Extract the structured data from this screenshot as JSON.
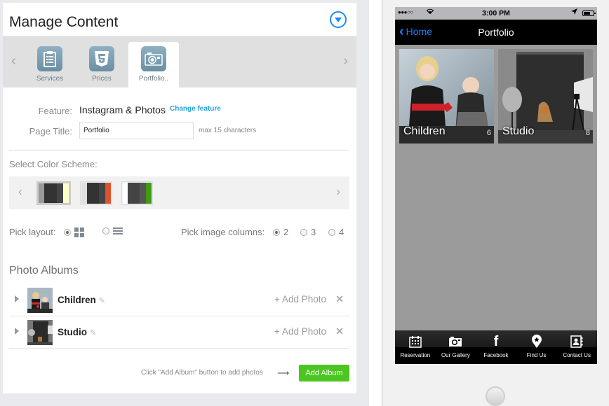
{
  "header": {
    "title": "Manage Content"
  },
  "tabs": [
    {
      "label": "Services",
      "icon": "clipboard-icon",
      "active": false
    },
    {
      "label": "Prices",
      "icon": "html5-icon",
      "active": false
    },
    {
      "label": "Portfolio..",
      "icon": "camera-icon",
      "active": true
    }
  ],
  "form": {
    "feature_label": "Feature:",
    "feature_value": "Instagram & Photos",
    "change_feature": "Change feature",
    "page_title_label": "Page Title:",
    "page_title_value": "Portfolio",
    "max_hint": "max 15 characters",
    "color_scheme_label": "Select Color Scheme:"
  },
  "color_schemes": [
    {
      "colors": [
        "#999999",
        "#333333",
        "#444444",
        "#ffffc8"
      ],
      "selected": true
    },
    {
      "colors": [
        "#e0e0e0",
        "#333333",
        "#444444",
        "#e0522c"
      ],
      "selected": false
    },
    {
      "colors": [
        "#ffffff",
        "#444444",
        "#555555",
        "#3f9a14"
      ],
      "selected": false
    }
  ],
  "layout": {
    "label": "Pick layout:",
    "options": [
      {
        "name": "grid",
        "checked": true
      },
      {
        "name": "list",
        "checked": false
      }
    ],
    "columns_label": "Pick image columns:",
    "columns": [
      {
        "value": "2",
        "checked": true
      },
      {
        "value": "3",
        "checked": false
      },
      {
        "value": "4",
        "checked": false
      }
    ]
  },
  "albums": {
    "title": "Photo Albums",
    "items": [
      {
        "name": "Children",
        "add_label": "+ Add Photo",
        "count": "6"
      },
      {
        "name": "Studio",
        "add_label": "+ Add Photo",
        "count": "8"
      }
    ],
    "hint": "Click \"Add Album\" button to add photos",
    "arrow": "⟶",
    "add_button": "Add Album"
  },
  "phone": {
    "status": {
      "signal": "●●●○○",
      "wifi": "◠",
      "time": "3:00 PM",
      "location": "➤"
    },
    "nav": {
      "back_label": "Home",
      "title": "Portfolio"
    },
    "tab_bar": [
      {
        "label": "Reservation",
        "icon": "calendar-icon"
      },
      {
        "label": "Our Gallery",
        "icon": "camera-icon"
      },
      {
        "label": "Facebook",
        "icon": "facebook-icon"
      },
      {
        "label": "Find Us",
        "icon": "map-pin-icon"
      },
      {
        "label": "Contact Us",
        "icon": "address-book-icon"
      }
    ]
  },
  "colors": {
    "accent": "#1a8cf0",
    "link": "#25a3d9",
    "add_button": "#4bc621",
    "ios_blue": "#1a80ff"
  }
}
